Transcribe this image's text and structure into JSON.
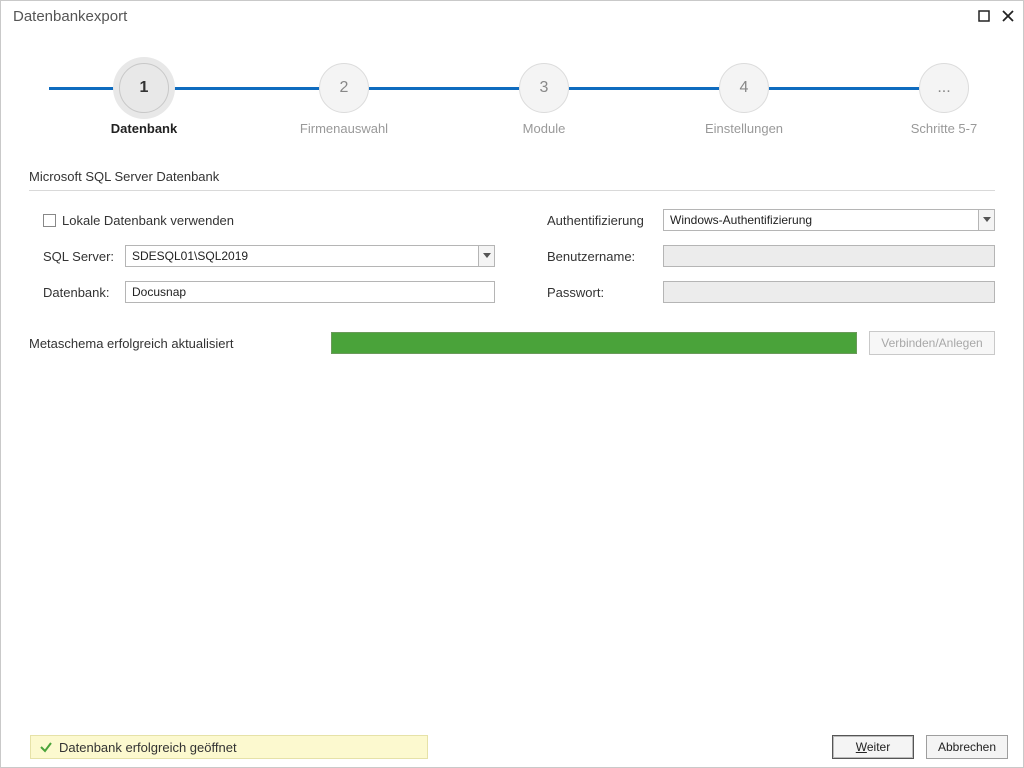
{
  "window": {
    "title": "Datenbankexport"
  },
  "stepper": {
    "steps": [
      {
        "num": "1",
        "label": "Datenbank",
        "active": true
      },
      {
        "num": "2",
        "label": "Firmenauswahl",
        "active": false
      },
      {
        "num": "3",
        "label": "Module",
        "active": false
      },
      {
        "num": "4",
        "label": "Einstellungen",
        "active": false
      },
      {
        "num": "...",
        "label": "Schritte 5-7",
        "active": false
      }
    ]
  },
  "section": {
    "title": "Microsoft SQL Server Datenbank"
  },
  "form": {
    "use_local_db_label": "Lokale Datenbank verwenden",
    "use_local_db_checked": false,
    "sql_server_label": "SQL Server:",
    "sql_server_value": "SDESQL01\\SQL2019",
    "database_label": "Datenbank:",
    "database_value": "Docusnap",
    "auth_label": "Authentifizierung",
    "auth_value": "Windows-Authentifizierung",
    "username_label": "Benutzername:",
    "username_value": "",
    "password_label": "Passwort:",
    "password_value": ""
  },
  "status": {
    "metaschema_text": "Metaschema erfolgreich aktualisiert",
    "connect_button": "Verbinden/Anlegen",
    "progress_percent": 100
  },
  "footer": {
    "banner_text": "Datenbank erfolgreich geöffnet",
    "next_label_pre": "",
    "next_label_mnemonic": "W",
    "next_label_post": "eiter",
    "cancel_label": "Abbrechen"
  }
}
